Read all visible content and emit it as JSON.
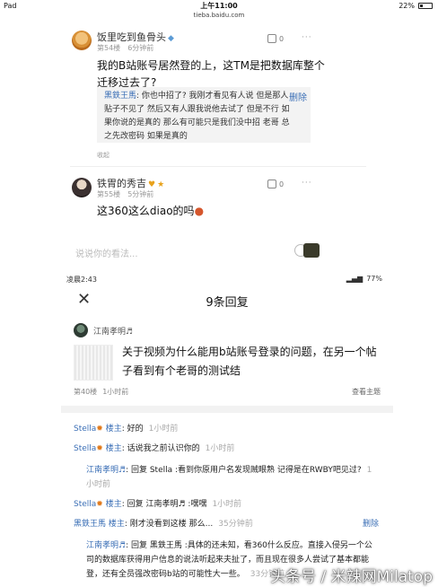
{
  "ipad_status": {
    "left": "Pad",
    "time": "上午11:00",
    "url": "tieba.baidu.com",
    "battery": "22%"
  },
  "post1": {
    "username": "饭里吃到鱼骨头",
    "floor": "第54楼",
    "time": "6分钟前",
    "likes": "0",
    "more": "···",
    "text": "我的B站账号居然登的上，这TM是把数据库整个迁移过去了?",
    "subreply": {
      "nick": "黑鉄王馬",
      "text": ": 你也中招了? 我刚才看见有人说 但是那人贴子不见了 然后又有人跟我说他去试了 但是不行 如果你说的是真的 那么有可能只是我们没中招 老哥 总之先改密码 如果是真的",
      "delete": "删除"
    },
    "fold": "收起"
  },
  "post2": {
    "username": "铁胃的秀吉",
    "floor": "第55楼",
    "time": "5分钟前",
    "likes": "0",
    "more": "···",
    "text": "这360这么diao的吗"
  },
  "comment_placeholder": "说说你的看法...",
  "phone_status": {
    "time": "凌晨2:43",
    "battery": "77%"
  },
  "phone_header": {
    "close": "✕",
    "title": "9条回复"
  },
  "main_post": {
    "author": "江南孝明♬",
    "text": "关于视频为什么能用b站账号登录的问题，在另一个帖子看到有个老哥的测试结",
    "floor": "第40楼",
    "time": "1小时前",
    "view": "查看主题"
  },
  "replies": [
    {
      "nick": "Stella",
      "role": "楼主",
      "text": ": 好的",
      "time": "1小时前"
    },
    {
      "nick": "Stella",
      "role": "楼主",
      "text": ": 话说我之前认识你的",
      "time": "1小时前"
    },
    {
      "nick": "江南孝明♬",
      "text": ": 回复 Stella :看到你原用户名发现贼眼熟 记得是在RWBY吧见过?",
      "time": "1小时前"
    },
    {
      "nick": "Stella",
      "role": "楼主",
      "text": ": 回复 江南孝明♬ :嘿嘿",
      "time": "1小时前"
    },
    {
      "nick": "黑鉄王馬",
      "role": "楼主",
      "text": ": 刚才没看到这楼 那么...",
      "time": "35分钟前",
      "delete": "删除"
    },
    {
      "nick": "江南孝明♬",
      "text": ": 回复 黑鉄王馬 :具体的还未知，看360什么反应。直接入侵另一个公司的数据库获得用户信息的说法听起来夫扯了，而且现在很多人尝试了基本都能登，还有全员强改密码b站的可能性大一些。",
      "time": "33分钟前"
    }
  ],
  "watermark": "头条号 / 米辣网Milatop"
}
